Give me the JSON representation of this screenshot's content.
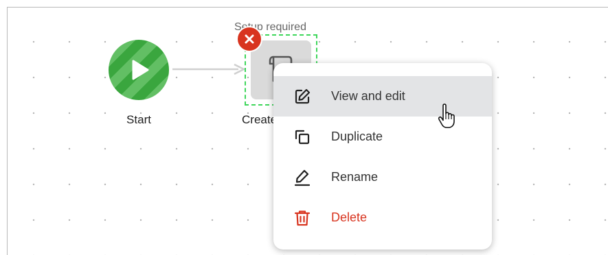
{
  "canvas": {
    "nodes": {
      "start": {
        "label": "Start",
        "icon": "play-icon",
        "color": "#3aa63e"
      },
      "create": {
        "label": "Create",
        "icon": "invoice-dollar-icon",
        "status": "Setup required",
        "error_icon": "close-icon",
        "error_color": "#d8341f"
      }
    }
  },
  "context_menu": {
    "items": [
      {
        "label": "View and edit",
        "icon": "edit-icon"
      },
      {
        "label": "Duplicate",
        "icon": "duplicate-icon"
      },
      {
        "label": "Rename",
        "icon": "rename-icon"
      },
      {
        "label": "Delete",
        "icon": "trash-icon",
        "color": "#d8341f"
      }
    ]
  }
}
